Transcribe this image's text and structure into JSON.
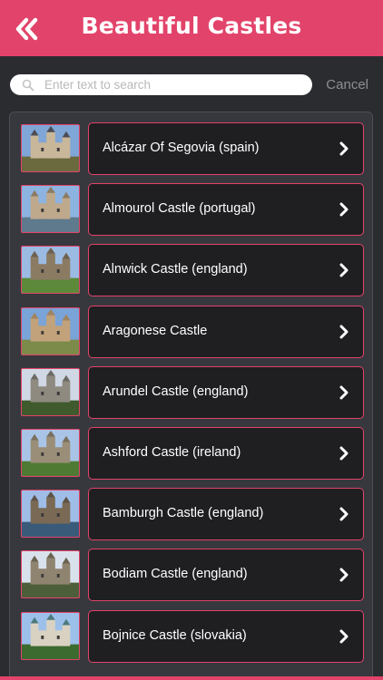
{
  "header": {
    "title": "Beautiful Castles",
    "back_icon": "double-chevron-left-icon",
    "background_color": "#e2436a"
  },
  "search": {
    "placeholder": "Enter text to search",
    "value": "",
    "cancel_label": "Cancel"
  },
  "list": {
    "accent_color": "#e2436a",
    "items": [
      {
        "label": "Alcázar Of Segovia (spain)",
        "thumb": "castle-photo"
      },
      {
        "label": "Almourol Castle (portugal)",
        "thumb": "castle-photo"
      },
      {
        "label": "Alnwick Castle (england)",
        "thumb": "castle-photo"
      },
      {
        "label": "Aragonese Castle",
        "thumb": "castle-photo"
      },
      {
        "label": "Arundel Castle (england)",
        "thumb": "castle-photo"
      },
      {
        "label": "Ashford Castle (ireland)",
        "thumb": "castle-photo"
      },
      {
        "label": "Bamburgh Castle (england)",
        "thumb": "castle-photo"
      },
      {
        "label": "Bodiam Castle (england)",
        "thumb": "castle-photo"
      },
      {
        "label": "Bojnice Castle (slovakia)",
        "thumb": "castle-photo"
      }
    ]
  }
}
